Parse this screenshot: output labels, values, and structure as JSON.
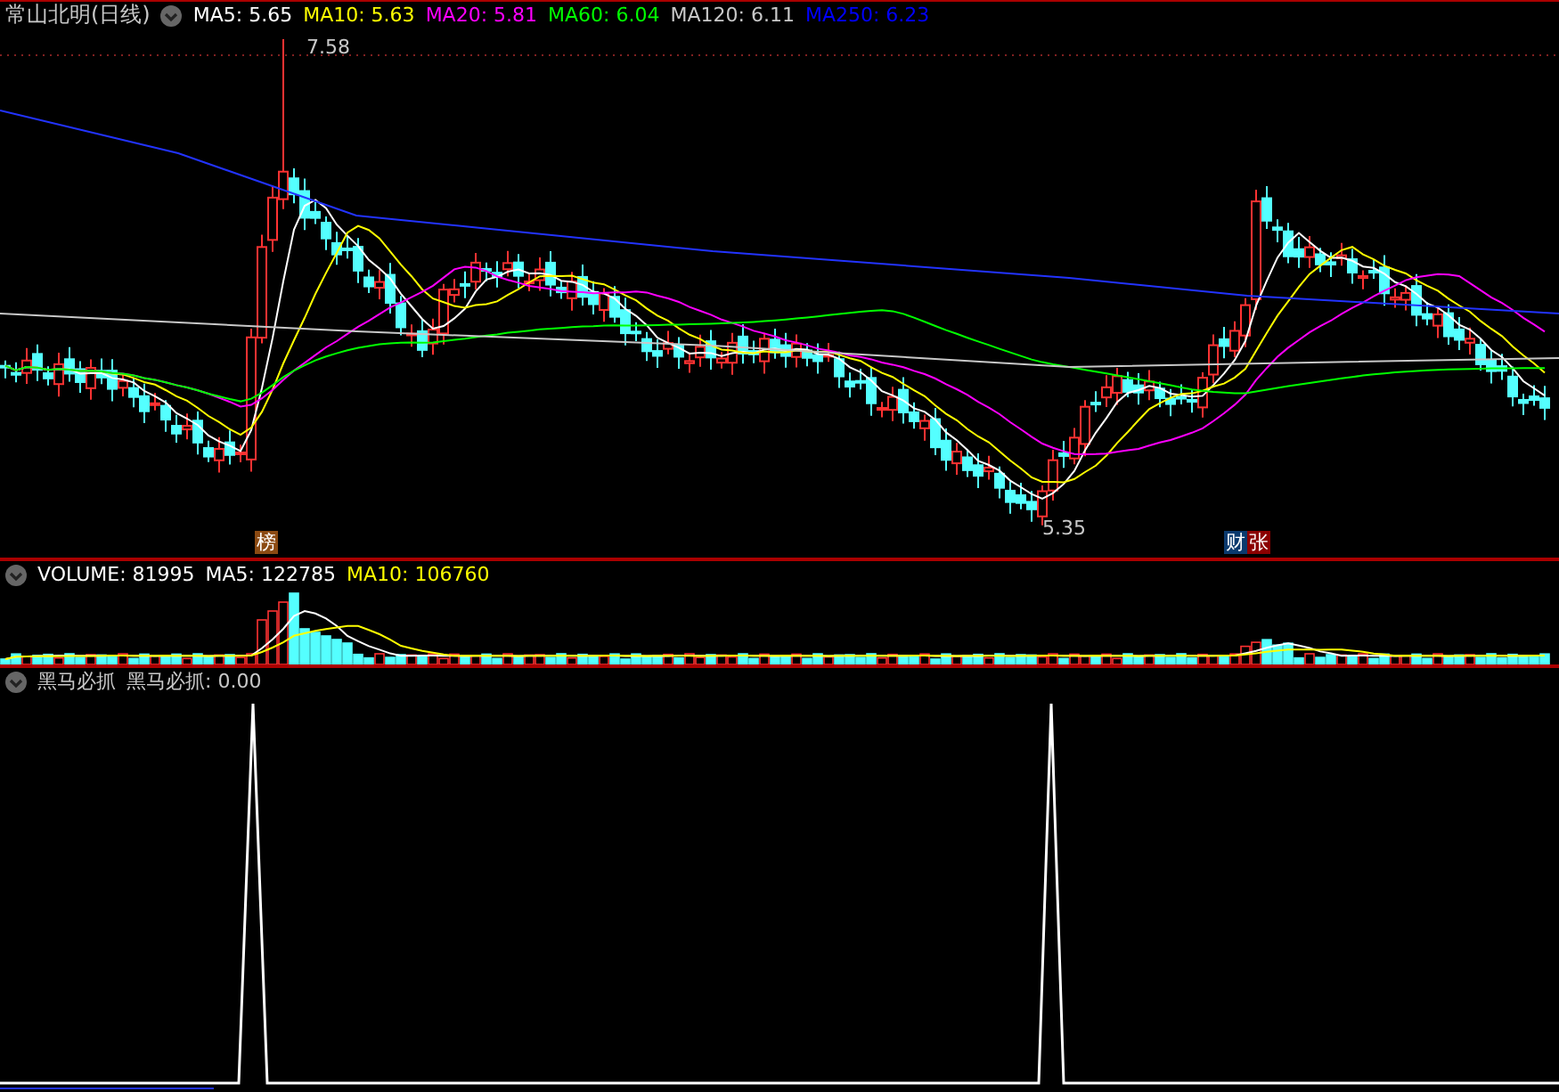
{
  "title": "常山北明(日线)",
  "ma_legend": [
    {
      "label": "MA5: 5.65",
      "color": "#ffffff"
    },
    {
      "label": "MA10: 5.63",
      "color": "#ffff00"
    },
    {
      "label": "MA20: 5.81",
      "color": "#ff00ff"
    },
    {
      "label": "MA60: 6.04",
      "color": "#00ff00"
    },
    {
      "label": "MA120: 6.11",
      "color": "#c8c8c8"
    },
    {
      "label": "MA250: 6.23",
      "color": "#0000ff"
    }
  ],
  "price_marks": {
    "high": "7.58",
    "low": "5.35"
  },
  "badges": [
    {
      "text": "榜",
      "color": "#8b4a12"
    },
    {
      "text": "财",
      "color": "#0a3a6e"
    },
    {
      "text": "张",
      "color": "#8b0000"
    }
  ],
  "volume_legend": [
    {
      "label": "VOLUME: 81995",
      "color": "#ffffff"
    },
    {
      "label": "MA5: 122785",
      "color": "#ffffff"
    },
    {
      "label": "MA10: 106760",
      "color": "#ffff00"
    }
  ],
  "indicator_legend": [
    "黑马必抓",
    "黑马必抓: 0.00"
  ]
}
